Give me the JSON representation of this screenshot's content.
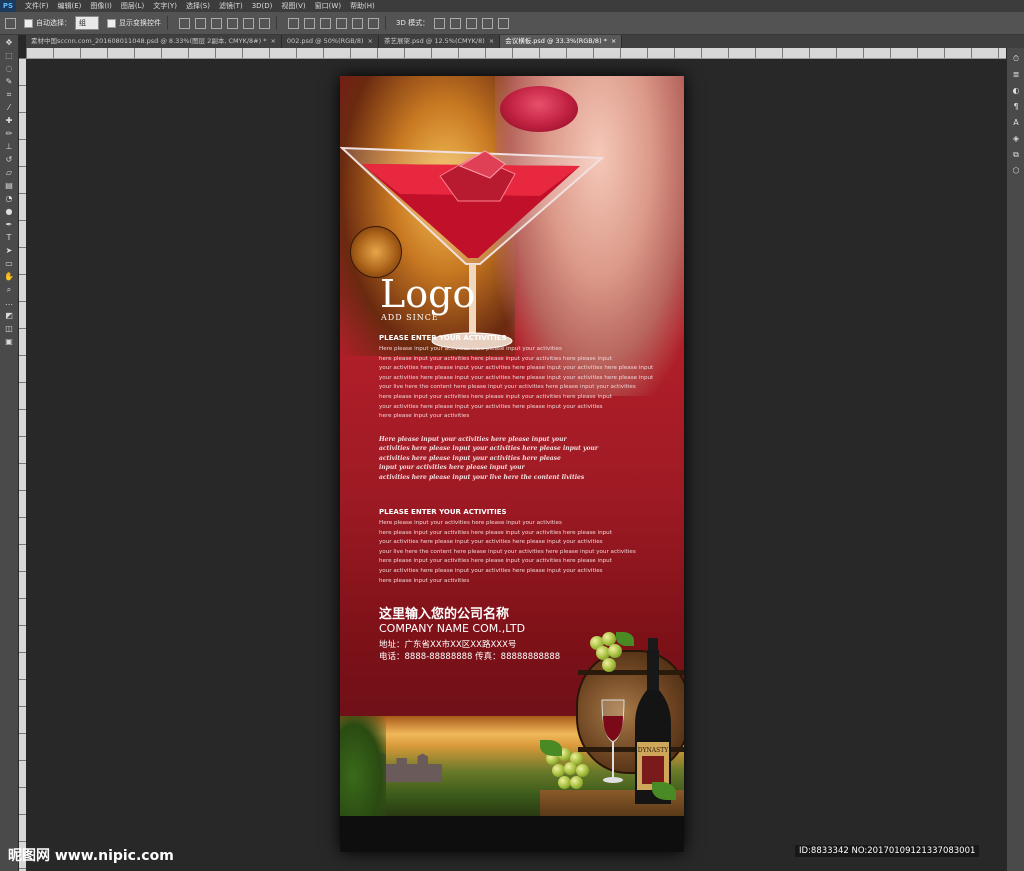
{
  "app": {
    "badge": "PS"
  },
  "menu": [
    "文件(F)",
    "编辑(E)",
    "图像(I)",
    "图层(L)",
    "文字(Y)",
    "选择(S)",
    "滤镜(T)",
    "3D(D)",
    "视图(V)",
    "窗口(W)",
    "帮助(H)"
  ],
  "options": {
    "auto_select_label": "自动选择：",
    "auto_select_value": "组",
    "show_transform_label": "显示变换控件",
    "mode_3d_label": "3D 模式："
  },
  "tabs": [
    {
      "label": "素材中国sccnn.com_201608011048.psd @ 8.33%(图层 2副本, CMYK/8#) *",
      "active": false
    },
    {
      "label": "002.psd @ 50%(RGB/8)",
      "active": false
    },
    {
      "label": "茶艺展架.psd @ 12.5%(CMYK/8)",
      "active": false
    },
    {
      "label": "会议横板.psd @ 33.3%(RGB/8) *",
      "active": true
    }
  ],
  "tab_close": "×",
  "poster": {
    "logo": "Logo",
    "logo_sub": "ADD SINCE",
    "section1": {
      "title": "PLEASE ENTER YOUR ACTIVITIES",
      "lines": [
        "Here please input your activities here please input your activities",
        "here please input your activities here please input your activities here please input",
        "your activities here please input your activities here please input your activities here please input",
        "your activities here please input your activities here please input your activities here please input",
        "your live here the content here please input your activities here please input your activities",
        "here please input your activities here please input your activities here please input",
        "your activities here please input your activities here please input your activities",
        "here please input your activities"
      ]
    },
    "script_lines": [
      "Here please input your activities here please input your",
      "activities here please input your activities here please input your",
      "activities here please input your activities here please",
      "input your activities here please input your",
      "activities here please input your live here the content livities"
    ],
    "section2": {
      "title": "PLEASE ENTER YOUR ACTIVITIES",
      "lines": [
        "Here please input your activities here please input your activities",
        "here please input your activities here please input your activities here please input",
        "your activities here please input your activities here please input your activities",
        "your live here the content here please input your activities here please input your activities",
        "here please input your activities here please input your activities here please input",
        "your activities here please input your activities here please input your activities",
        "here please input your activities"
      ]
    },
    "company_cn": "这里输入您的公司名称",
    "company_en": "COMPANY NAME COM.,LTD",
    "address": "地址：广东省XX市XX区XX路XXX号",
    "phone": "电话：8888-88888888  传真：88888888888",
    "bottle_brand": "DYNASTY"
  },
  "watermark": {
    "left": "昵图网 www.nipic.com",
    "right": "ID:8833342 NO:20170109121337083001"
  },
  "colors": {
    "poster_red": "#b31f2a",
    "ps_bg": "#282828",
    "panel": "#535353"
  }
}
